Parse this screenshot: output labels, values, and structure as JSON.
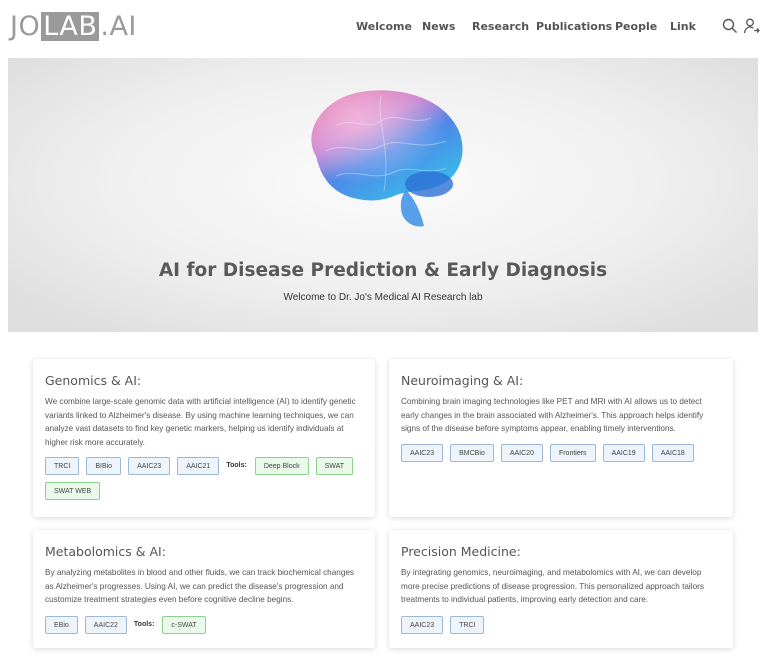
{
  "header": {
    "logo": {
      "prefix": "JO",
      "boxed": "LAB",
      "suffix": ".AI"
    },
    "nav": [
      "Welcome",
      "News",
      "Research",
      "Publications",
      "People",
      "Link"
    ],
    "icons": [
      "search-icon",
      "user-login-icon"
    ]
  },
  "hero": {
    "title": "AI for Disease Prediction & Early Diagnosis",
    "subtitle": "Welcome to Dr. Jo's Medical AI Research lab"
  },
  "cards": [
    {
      "title": "Genomics & AI:",
      "body": "We combine large-scale genomic data with artificial intelligence (AI) to identify genetic variants linked to Alzheimer's disease. By using machine learning techniques, we can analyze vast datasets to find key genetic markers, helping us identify individuals at higher risk more accurately.",
      "tags": [
        "TRCI",
        "BIBio",
        "AAIC23",
        "AAIC21"
      ],
      "tools_label": "Tools:",
      "tools": [
        "Deep Block",
        "SWAT",
        "SWAT WEB"
      ]
    },
    {
      "title": "Neuroimaging & AI:",
      "body": "Combining brain imaging technologies like PET and MRI with AI allows us to detect early changes in the brain associated with Alzheimer's. This approach helps identify signs of the disease before symptoms appear, enabling timely interventions.",
      "tags": [
        "AAIC23",
        "BMCBio",
        "AAIC20",
        "Frontiers",
        "AAIC19",
        "AAIC18"
      ]
    },
    {
      "title": "Metabolomics & AI:",
      "body": "By analyzing metabolites in blood and other fluids, we can track biochemical changes as Alzheimer's progresses. Using AI, we can predict the disease's progression and customize treatment strategies even before cognitive decline begins.",
      "tags": [
        "EBio",
        "AAIC22"
      ],
      "tools_label": "Tools:",
      "tools": [
        "c-SWAT"
      ]
    },
    {
      "title": "Precision Medicine:",
      "body": "By integrating genomics, neuroimaging, and metabolomics with AI, we can develop more precise predictions of disease progression. This personalized approach tailors treatments to individual patients, improving early detection and care.",
      "tags": [
        "AAIC23",
        "TRCI"
      ]
    }
  ],
  "colors": {
    "nav_text": "#555555",
    "logo_gray": "#9a9a9a",
    "tag_border_blue": "#9db8d6",
    "tag_border_green": "#8fd08f"
  }
}
